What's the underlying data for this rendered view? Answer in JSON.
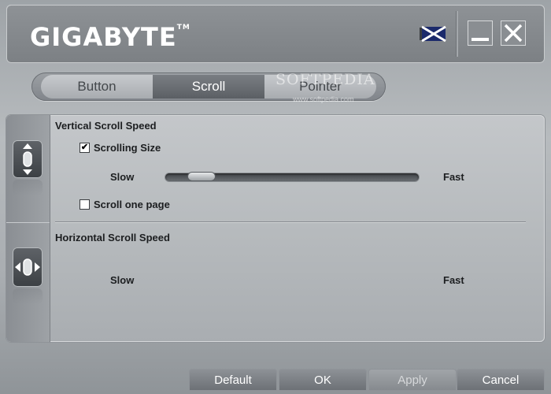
{
  "app": {
    "logo": "GIGABYTE",
    "trademark": "TM"
  },
  "tabs": [
    {
      "label": "Button",
      "active": false
    },
    {
      "label": "Scroll",
      "active": true
    },
    {
      "label": "Pointer",
      "active": false
    }
  ],
  "watermark": {
    "text": "SOFTPEDIA",
    "sub": "www.softpedia.com"
  },
  "vertical": {
    "title": "Vertical Scroll Speed",
    "scrolling_size_label": "Scrolling Size",
    "scrolling_size_checked": true,
    "slow_label": "Slow",
    "fast_label": "Fast",
    "speed_percent": 10,
    "scroll_one_page_label": "Scroll one page",
    "scroll_one_page_checked": false
  },
  "horizontal": {
    "title": "Horizontal Scroll Speed",
    "slow_label": "Slow",
    "fast_label": "Fast"
  },
  "footer": {
    "default_label": "Default",
    "ok_label": "OK",
    "apply_label": "Apply",
    "cancel_label": "Cancel"
  },
  "check_mark": "✔",
  "colors": {
    "active_tab": "#5b5f64",
    "text": "#1c1e20",
    "flag_blue": "#1b2a6b"
  }
}
